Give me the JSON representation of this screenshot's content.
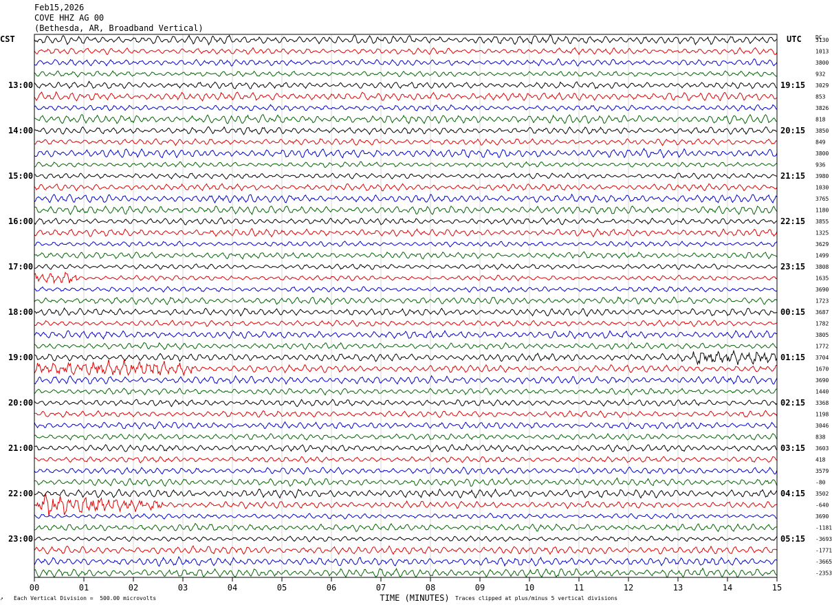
{
  "header": {
    "date": "Feb15,2026",
    "station": "COVE HHZ AG 00",
    "location": "(Bethesda, AR, Broadband Vertical)"
  },
  "labels": {
    "left_tz": "CST",
    "right_tz": "UTC",
    "dc": "DC"
  },
  "footer": {
    "scale_note": "Each Vertical Division =  500.00 microvolts",
    "clip_note": "Traces clipped at plus/minus 5 vertical divisions"
  },
  "chart_data": {
    "type": "line",
    "title": "COVE HHZ AG 00",
    "xlabel": "TIME (MINUTES)",
    "ylabel": "",
    "xlim": [
      0,
      15
    ],
    "x_ticks": [
      "00",
      "01",
      "02",
      "03",
      "04",
      "05",
      "06",
      "07",
      "08",
      "09",
      "10",
      "11",
      "12",
      "13",
      "14",
      "15"
    ],
    "left_time_labels": [
      "13:00",
      "14:00",
      "15:00",
      "16:00",
      "17:00",
      "18:00",
      "19:00",
      "20:00",
      "21:00",
      "22:00",
      "23:00"
    ],
    "right_time_labels": [
      "19:15",
      "20:15",
      "21:15",
      "22:15",
      "23:15",
      "00:15",
      "01:15",
      "02:15",
      "03:15",
      "04:15",
      "05:15"
    ],
    "trace_colors": [
      "#000000",
      "#e00000",
      "#0000d0",
      "#006400"
    ],
    "trace_count": 48,
    "dc_offsets": [
      "3130",
      "1013",
      "3800",
      "932",
      "3029",
      "853",
      "3826",
      "818",
      "3850",
      "849",
      "3800",
      "936",
      "3980",
      "1030",
      "3765",
      "1180",
      "3855",
      "1325",
      "3629",
      "1499",
      "3808",
      "1635",
      "3690",
      "1723",
      "3687",
      "1782",
      "3805",
      "1772",
      "3704",
      "1670",
      "3690",
      "1440",
      "3368",
      "1198",
      "3046",
      "838",
      "3603",
      "418",
      "3579",
      "-80",
      "3502",
      "-640",
      "3690",
      "-1181",
      "-3693",
      "-1771",
      "-3665",
      "-2353"
    ],
    "events": [
      {
        "trace": 21,
        "minute_start": 0.0,
        "minute_end": 0.9,
        "label": "burst"
      },
      {
        "trace": 28,
        "minute_start": 13.3,
        "minute_end": 15.0,
        "label": "noise"
      },
      {
        "trace": 29,
        "minute_start": 0.0,
        "minute_end": 3.2,
        "label": "burst"
      },
      {
        "trace": 41,
        "minute_start": 0.0,
        "minute_end": 2.6,
        "label": "earthquake"
      }
    ]
  }
}
